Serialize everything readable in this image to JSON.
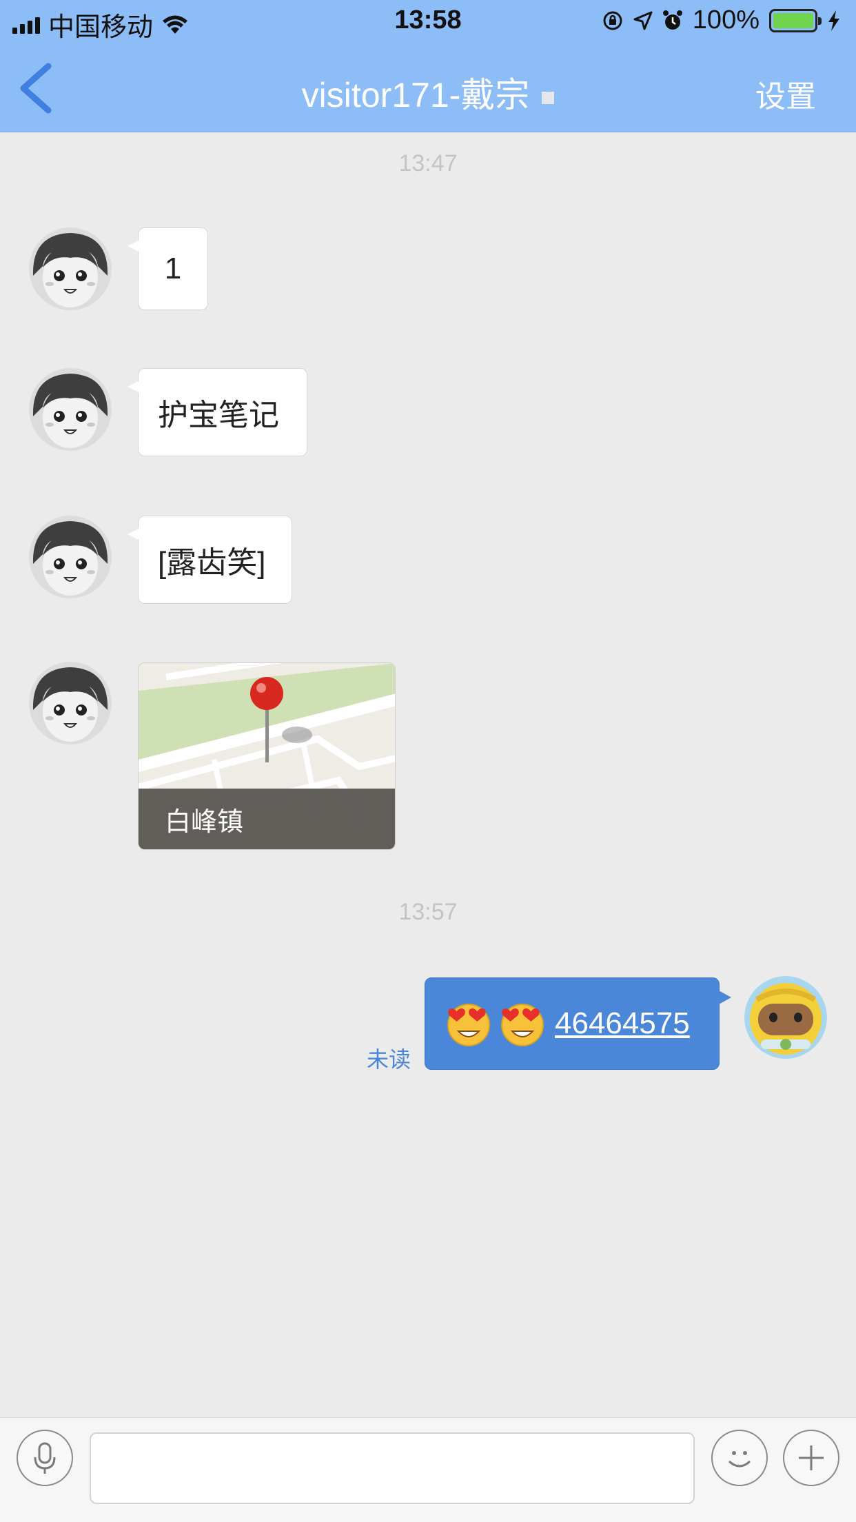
{
  "status_bar": {
    "carrier": "中国移动",
    "time": "13:58",
    "battery": "100%"
  },
  "nav": {
    "title": "visitor171-戴宗",
    "settings_label": "设置"
  },
  "messages": {
    "timestamp_1": "13:47",
    "msg_1": "1",
    "msg_2": "护宝笔记",
    "msg_3": "[露齿笑]",
    "location_caption": "白峰镇",
    "timestamp_2": "13:57",
    "outgoing_number": "46464575",
    "unread_label": "未读"
  },
  "input": {
    "value": ""
  },
  "colors": {
    "nav_bar": "#8dbdf6",
    "outgoing_bubble": "#4a87d8",
    "background": "#ebebeb"
  },
  "icons": [
    "back-chevron-icon",
    "wifi-icon",
    "signal-icon",
    "orientation-lock-icon",
    "location-arrow-icon",
    "alarm-icon",
    "battery-icon",
    "charging-icon",
    "microphone-icon",
    "emoji-face-icon",
    "plus-icon",
    "heart-eyes-emoji-icon",
    "map-pin-icon"
  ]
}
